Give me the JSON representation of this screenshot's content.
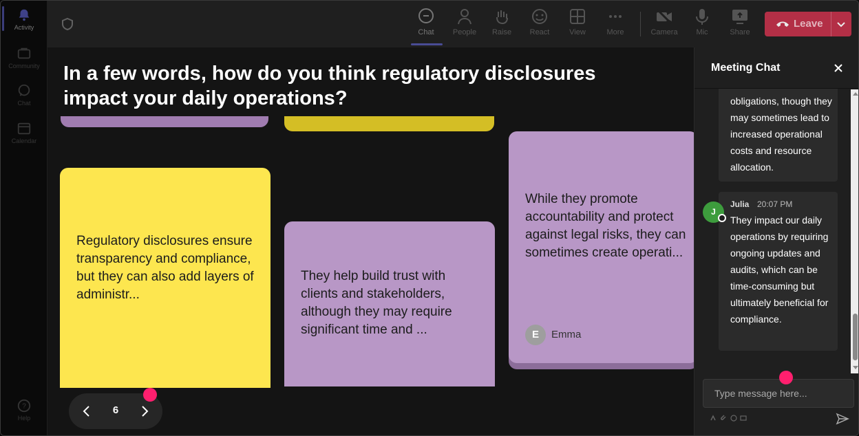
{
  "rail": {
    "items": [
      {
        "label": "Activity"
      },
      {
        "label": "Community"
      },
      {
        "label": "Chat"
      },
      {
        "label": "Calendar"
      },
      {
        "label": "Help"
      }
    ]
  },
  "toolbar": {
    "chat": "Chat",
    "people": "People",
    "raise": "Raise",
    "react": "React",
    "view": "View",
    "more": "More",
    "camera": "Camera",
    "mic": "Mic",
    "share": "Share",
    "leave": "Leave"
  },
  "stage": {
    "question": "In a few words, how do you think regulatory disclosures impact your daily operations?",
    "notes": [
      {
        "text": "Regulatory disclosures ensure transparency and compliance, but they can also add layers of administr..."
      },
      {
        "text": "They help build trust with clients and stakeholders, although they may require significant time and ..."
      },
      {
        "text": "While they promote accountability and protect against legal risks, they can sometimes create operati...",
        "author": "Emma",
        "author_initial": "E"
      }
    ],
    "pager": {
      "page": "6"
    }
  },
  "chat": {
    "title": "Meeting Chat",
    "messages": [
      {
        "text": "obligations, though they may sometimes lead to increased operational costs and resource allocation."
      },
      {
        "sender": "Julia",
        "initial": "J",
        "time": "20:07 PM",
        "text": "They impact our daily operations by requiring ongoing updates and audits, which can be time-consuming but ultimately beneficial for compliance."
      }
    ],
    "placeholder": "Type message here..."
  },
  "colors": {
    "accent": "#5b5fc7",
    "leave": "#c4314b",
    "note_yellow": "#fde64f",
    "note_purple": "#b897c6",
    "avatar_green": "#3d9c3d",
    "pink_dot": "#ff1f6e"
  }
}
